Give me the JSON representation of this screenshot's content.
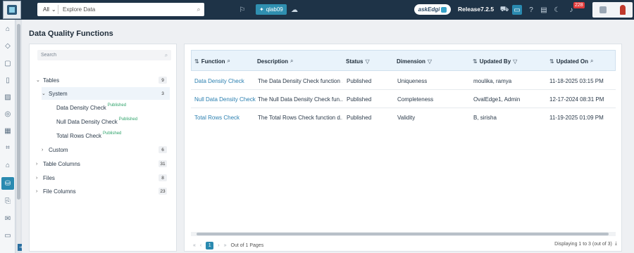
{
  "header": {
    "search_scope": "All",
    "search_placeholder": "Explore Data",
    "environment": "qlab09",
    "ask_label": "askEdgi",
    "release": "Release7.2.5",
    "notification_count": "228"
  },
  "page": {
    "title": "Data Quality Functions"
  },
  "tree": {
    "search_placeholder": "Search",
    "published_label": "Published",
    "nodes": [
      {
        "label": "Tables",
        "count": "9"
      },
      {
        "label": "System",
        "count": "3"
      },
      {
        "label": "Data Density Check"
      },
      {
        "label": "Null Data Density Check"
      },
      {
        "label": "Total Rows Check"
      },
      {
        "label": "Custom",
        "count": "6"
      },
      {
        "label": "Table Columns",
        "count": "31"
      },
      {
        "label": "Files",
        "count": "8"
      },
      {
        "label": "File Columns",
        "count": "23"
      }
    ]
  },
  "table": {
    "columns": [
      "Function",
      "Description",
      "Status",
      "Dimension",
      "Updated By",
      "Updated On"
    ],
    "rows": [
      [
        "Data Density Check",
        "The Data Density Check function ...",
        "Published",
        "Uniqueness",
        "moulika, ramya",
        "11-18-2025 03:15 PM"
      ],
      [
        "Null Data Density Check",
        "The Null Data Density Check fun...",
        "Published",
        "Completeness",
        "OvalEdge1, Admin",
        "12-17-2024 08:31 PM"
      ],
      [
        "Total Rows Check",
        "The Total Rows Check function d...",
        "Published",
        "Validity",
        "B, sirisha",
        "11-19-2025 01:09 PM"
      ]
    ]
  },
  "pagination": {
    "current_page": "1",
    "out_of": "Out of 1 Pages",
    "display_info": "Displaying 1 to 3 (out of 3)"
  },
  "colors": {
    "topbar": "#1e3347",
    "accent": "#2a8ab0",
    "link": "#2a7fb0",
    "published": "#2ea36a"
  }
}
